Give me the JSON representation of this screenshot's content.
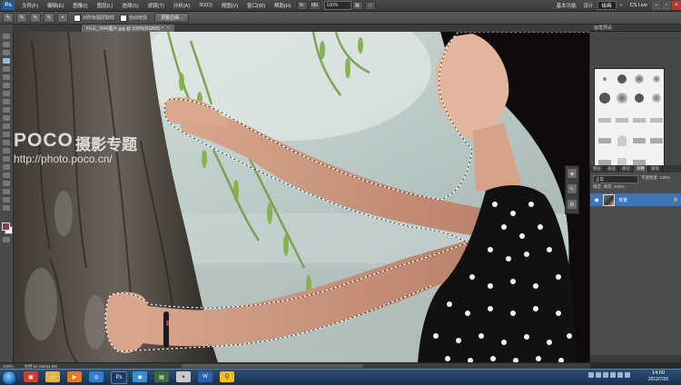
{
  "app": {
    "logo": "Ps",
    "menu": [
      "文件(F)",
      "编辑(E)",
      "图像(I)",
      "图层(L)",
      "选择(S)",
      "滤镜(T)",
      "分析(A)",
      "3D(D)",
      "视图(V)",
      "窗口(W)",
      "帮助(H)"
    ],
    "zoom": "100%",
    "workspaces": [
      "基本功能",
      "设计",
      "绘画"
    ],
    "active_workspace": "设计",
    "cs_live": "CS Live"
  },
  "options_bar": {
    "sample_all_layers_label": "对所有图层取样",
    "auto_enhance_label": "自动增强",
    "refine_edge_label": "调整边缘..."
  },
  "document": {
    "tab_label": "FILE_7846图片.jpg @ 100%(RGB/8) *",
    "status_zoom": "100%",
    "status_doc": "文档:54.0M/54.0M"
  },
  "watermark": {
    "brand": "POCO",
    "chinese": "摄影专题",
    "url": "http://photo.poco.cn/"
  },
  "panels": {
    "brushes_header": "画笔预设",
    "layers_tabs": [
      "图层",
      "通道",
      "路径",
      "调整",
      "蒙版"
    ],
    "active_layer_tab": "图层",
    "blend_mode": "正常",
    "opacity_label": "不透明度: 100%",
    "lock_label": "锁定:   填充: 100%",
    "layer_name": "背景"
  },
  "taskbar": {
    "time": "14:00",
    "date": "2012/7/26"
  },
  "colors": {
    "foreground": "#8f3752",
    "background": "#ffffff",
    "accent": "#3e74b8"
  }
}
